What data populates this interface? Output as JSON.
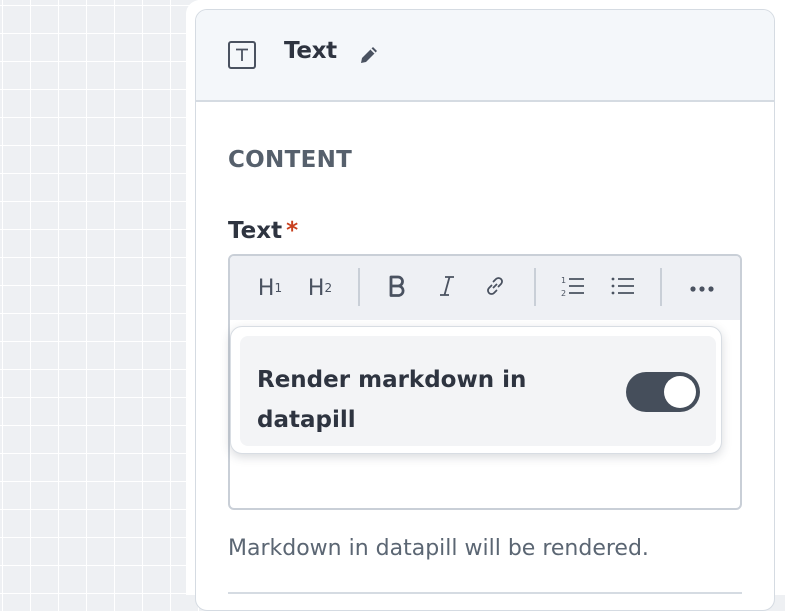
{
  "panel": {
    "title": "Text",
    "type_icon": "text-type-icon",
    "edit_icon": "pencil-icon"
  },
  "section": {
    "title": "CONTENT"
  },
  "field": {
    "label": "Text",
    "required_marker": "*"
  },
  "toolbar": {
    "items": [
      {
        "name": "heading-1",
        "text": "H",
        "sub": "1"
      },
      {
        "name": "heading-2",
        "text": "H",
        "sub": "2"
      },
      {
        "name": "bold-icon"
      },
      {
        "name": "italic-icon"
      },
      {
        "name": "link-icon"
      },
      {
        "name": "ordered-list-icon"
      },
      {
        "name": "bullet-list-icon"
      },
      {
        "name": "more-options-icon"
      }
    ]
  },
  "popover": {
    "label": "Render markdown in datapill",
    "toggle_on": true
  },
  "helper_text": "Markdown in datapill will be rendered.",
  "colors": {
    "required": "#c8401e",
    "toggle": "#454e5b",
    "header_bg": "#f4f7fa"
  }
}
